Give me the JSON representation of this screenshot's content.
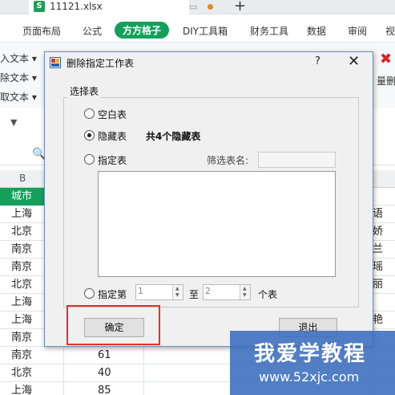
{
  "app": {
    "file_name": "11121.xlsx",
    "file_icon_letter": "S"
  },
  "ribbon_tabs": [
    {
      "label": "页面布局",
      "active": false
    },
    {
      "label": "公式",
      "active": false
    },
    {
      "label": "方方格子",
      "active": true
    },
    {
      "label": "DIY工具箱",
      "active": false
    },
    {
      "label": "财务工具",
      "active": false
    },
    {
      "label": "数据",
      "active": false
    },
    {
      "label": "审阅",
      "active": false
    },
    {
      "label": "视",
      "active": false
    }
  ],
  "ribbon_items": [
    {
      "label": "入文本 ▾"
    },
    {
      "label": "除文本 ▾"
    },
    {
      "label": "取文本 ▾"
    }
  ],
  "ribbon_right_label": "量删",
  "column_header": "B",
  "sheet": {
    "header": "城市",
    "rows": [
      {
        "city": "上海",
        "value": "",
        "right": "语"
      },
      {
        "city": "北京",
        "value": "",
        "right": "娇"
      },
      {
        "city": "南京",
        "value": "",
        "right": "兰"
      },
      {
        "city": "南京",
        "value": "",
        "right": "瑶"
      },
      {
        "city": "北京",
        "value": "",
        "right": "丽"
      },
      {
        "city": "上海",
        "value": "",
        "right": ""
      },
      {
        "city": "上海",
        "value": "",
        "right": "艳"
      },
      {
        "city": "南京",
        "value": "",
        "right": ""
      },
      {
        "city": "南京",
        "value": "61",
        "right": ""
      },
      {
        "city": "北京",
        "value": "40",
        "right": ""
      },
      {
        "city": "上海",
        "value": "85",
        "right": ""
      }
    ]
  },
  "dialog": {
    "title": "删除指定工作表",
    "help": "?",
    "close": "✕",
    "group_label": "选择表",
    "option_blank": "空白表",
    "option_hidden": "隐藏表",
    "hidden_count_note": "共4个隐藏表",
    "option_specified": "指定表",
    "filter_label": "筛选表名:",
    "filter_value": "",
    "option_range_prefix": "指定第",
    "range_from": "1",
    "range_to_label": "至",
    "range_to": "2",
    "range_suffix": "个表",
    "ok_button": "确定",
    "exit_button": "退出",
    "selected_option": "hidden"
  },
  "watermark": {
    "title": "我爱学教程",
    "url": "www.52xjc.com"
  }
}
